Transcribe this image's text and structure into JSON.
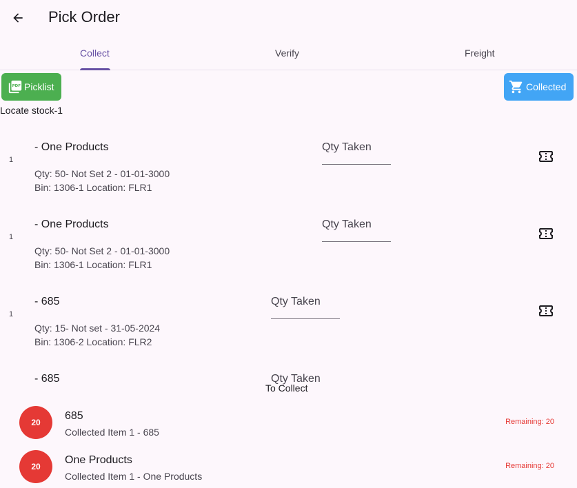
{
  "header": {
    "title": "Pick Order",
    "back_icon": "arrow-left-icon"
  },
  "tabs": [
    {
      "label": "Collect",
      "active": true
    },
    {
      "label": "Verify",
      "active": false
    },
    {
      "label": "Freight",
      "active": false
    }
  ],
  "actions": {
    "picklist_label": "Picklist",
    "picklist_icon": "pdf-icon",
    "picklist_color": "#4caf50",
    "collected_label": "Collected",
    "collected_icon": "cart-icon",
    "collected_color": "#42a5f5"
  },
  "section_label": "Locate stock-1",
  "pick_items": [
    {
      "index": "1",
      "name": "- One Products",
      "qty_label": "Qty Taken",
      "detail1": "Qty: 50- Not Set 2 - 01-01-3000",
      "detail2": "Bin: 1306-1 Location: FLR1"
    },
    {
      "index": "1",
      "name": "- One Products",
      "qty_label": "Qty Taken",
      "detail1": "Qty: 50- Not Set 2 - 01-01-3000",
      "detail2": "Bin: 1306-1 Location: FLR1"
    },
    {
      "index": "1",
      "name": "- 685",
      "qty_label": "Qty Taken",
      "detail1": "Qty: 15- Not set - 31-05-2024",
      "detail2": "Bin: 1306-2 Location: FLR2"
    },
    {
      "name": "- 685",
      "qty_label": "Qty Taken"
    }
  ],
  "to_collect_label": "To Collect",
  "collect_items": [
    {
      "badge": "20",
      "name": "685",
      "subtitle": "Collected Item 1 - 685",
      "remaining": "Remaining: 20"
    },
    {
      "badge": "20",
      "name": "One Products",
      "subtitle": "Collected Item 1 - One Products",
      "remaining": "Remaining: 20"
    }
  ],
  "colors": {
    "accent": "#6750a4",
    "badge": "#e53935",
    "background": "#fdf7fc"
  }
}
